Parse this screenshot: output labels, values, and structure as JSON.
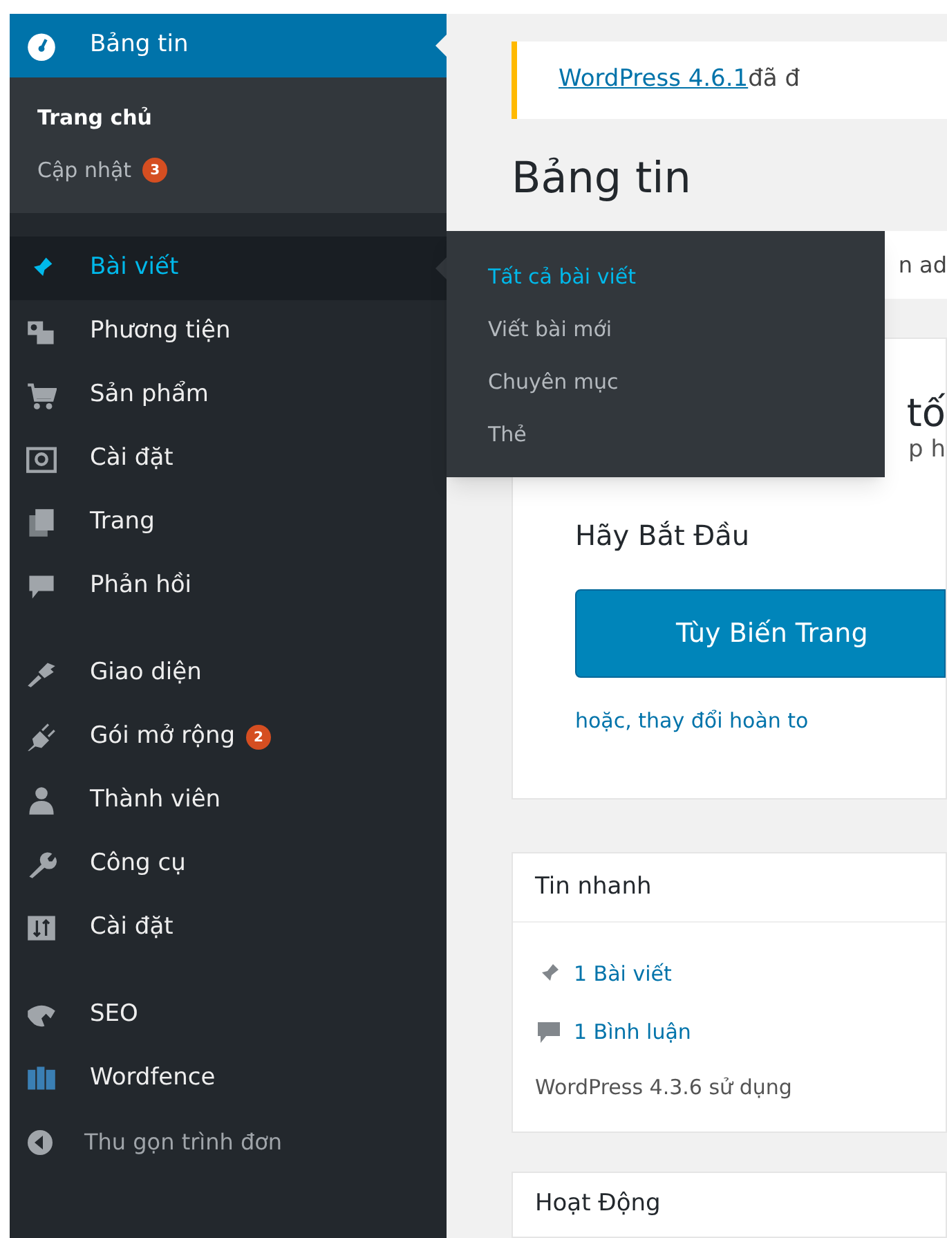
{
  "sidebar": {
    "items": [
      {
        "kind": "item",
        "label": "Bảng tin",
        "selected": true,
        "hovered": false,
        "submenu": [
          {
            "label": "Trang chủ",
            "selected": true
          },
          {
            "label": "Cập nhật",
            "selected": false,
            "badge": "3"
          }
        ]
      },
      {
        "kind": "separator"
      },
      {
        "kind": "item",
        "label": "Bài viết",
        "selected": false,
        "hovered": true
      },
      {
        "kind": "item",
        "label": "Phương tiện",
        "selected": false,
        "hovered": false
      },
      {
        "kind": "item",
        "label": "Sản phẩm",
        "selected": false,
        "hovered": false
      },
      {
        "kind": "item",
        "label": "Cài đặt",
        "selected": false,
        "hovered": false
      },
      {
        "kind": "item",
        "label": "Trang",
        "selected": false,
        "hovered": false
      },
      {
        "kind": "item",
        "label": "Phản hồi",
        "selected": false,
        "hovered": false
      },
      {
        "kind": "separator"
      },
      {
        "kind": "item",
        "label": "Giao diện",
        "selected": false,
        "hovered": false
      },
      {
        "kind": "item",
        "label": "Gói mở rộng",
        "selected": false,
        "hovered": false,
        "badge": "2"
      },
      {
        "kind": "item",
        "label": "Thành viên",
        "selected": false,
        "hovered": false
      },
      {
        "kind": "item",
        "label": "Công cụ",
        "selected": false,
        "hovered": false
      },
      {
        "kind": "item",
        "label": "Cài đặt",
        "selected": false,
        "hovered": false
      },
      {
        "kind": "separator"
      },
      {
        "kind": "item",
        "label": "SEO",
        "selected": false,
        "hovered": false
      },
      {
        "kind": "item",
        "label": "Wordfence",
        "selected": false,
        "hovered": false
      },
      {
        "kind": "collapse",
        "label": "Thu gọn trình đơn"
      }
    ]
  },
  "flyout_menu": {
    "items": [
      {
        "label": "Tất cả bài viết",
        "selected": true
      },
      {
        "label": "Viết bài mới",
        "selected": false
      },
      {
        "label": "Chuyên mục",
        "selected": false
      },
      {
        "label": "Thẻ",
        "selected": false
      }
    ]
  },
  "update_notice": {
    "link": "WordPress 4.6.1",
    "text": "đã đ"
  },
  "page_title": "Bảng tin",
  "error_notice": {
    "text": "n ad"
  },
  "welcome_panel": {
    "heading": "tố",
    "subtext": "p h",
    "column_title": "Hãy Bắt Đầu",
    "button": "Tùy Biến Trang",
    "link_text": "hoặc, thay đổi hoàn to"
  },
  "at_a_glance": {
    "title": "Tin nhanh",
    "items": [
      {
        "kind": "posts",
        "label": "1 Bài viết"
      },
      {
        "kind": "comments",
        "label": "1 Bình luận"
      }
    ],
    "footer": "WordPress 4.3.6 sử dụng"
  },
  "activity": {
    "title": "Hoạt Động"
  }
}
